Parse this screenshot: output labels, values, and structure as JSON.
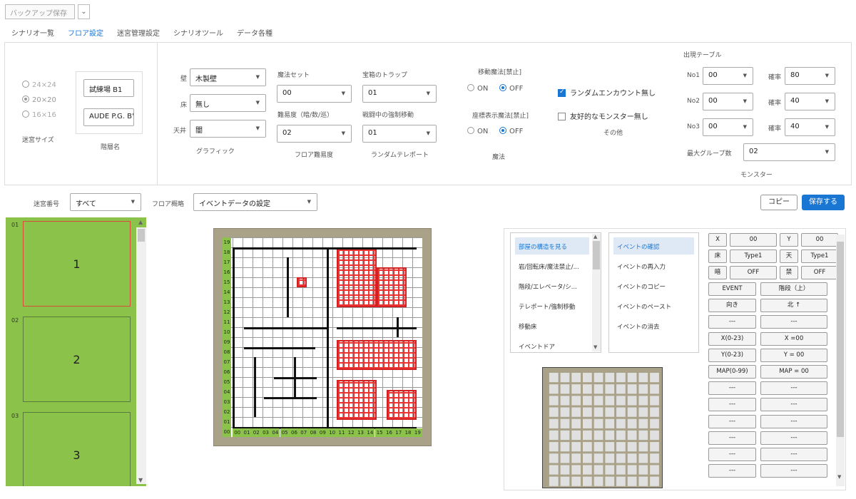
{
  "top": {
    "backup_label": "バックアップ保存"
  },
  "tabs": [
    {
      "label": "シナリオ一覧"
    },
    {
      "label": "フロア設定"
    },
    {
      "label": "迷宮管理設定"
    },
    {
      "label": "シナリオツール"
    },
    {
      "label": "データ各種"
    }
  ],
  "size": {
    "opt1": "24×24",
    "opt2": "20×20",
    "opt3": "16×16",
    "caption": "迷宮サイズ",
    "selected": "20×20"
  },
  "floorname": {
    "name1": "試練場 B1",
    "name2": "AUDE P.G. B'",
    "caption": "階層名"
  },
  "graphic": {
    "wall_label": "壁",
    "wall_value": "木製壁",
    "floor_label": "床",
    "floor_value": "無し",
    "ceiling_label": "天井",
    "ceiling_value": "闇",
    "caption": "グラフィック"
  },
  "difficulty": {
    "magicset_label": "魔法セット",
    "magicset_value": "00",
    "level_label": "難易度（暗/数/巡）",
    "level_value": "02",
    "caption": "フロア難易度"
  },
  "teleport": {
    "trap_label": "宝箱のトラップ",
    "trap_value": "01",
    "force_label": "戦闘中の強制移動",
    "force_value": "01",
    "caption": "ランダムテレポート"
  },
  "magic": {
    "move_label": "移動魔法[禁止]",
    "move_on": "ON",
    "move_off": "OFF",
    "coord_label": "座標表示魔法[禁止]",
    "coord_on": "ON",
    "coord_off": "OFF",
    "caption": "魔法"
  },
  "other": {
    "random_label": "ランダムエンカウント無し",
    "friendly_label": "友好的なモンスター無し",
    "caption": "その他"
  },
  "monster": {
    "table_label": "出現テーブル",
    "rows": [
      {
        "no": "No1",
        "value": "00",
        "rate_label": "確率",
        "rate": "80"
      },
      {
        "no": "No2",
        "value": "00",
        "rate_label": "確率",
        "rate": "40"
      },
      {
        "no": "No3",
        "value": "00",
        "rate_label": "確率",
        "rate": "40"
      }
    ],
    "maxgroup_label": "最大グループ数",
    "maxgroup_value": "02",
    "caption": "モンスター"
  },
  "toolbar": {
    "maze_no_label": "迷宮番号",
    "maze_no_value": "すべて",
    "outline_label": "フロア概略",
    "outline_value": "イベントデータの設定",
    "copy": "コピー",
    "save": "保存する"
  },
  "floors": [
    {
      "no": "01",
      "title": "1"
    },
    {
      "no": "02",
      "title": "2"
    },
    {
      "no": "03",
      "title": "3"
    }
  ],
  "map": {
    "rows": [
      "19",
      "18",
      "17",
      "16",
      "15",
      "14",
      "13",
      "12",
      "11",
      "10",
      "09",
      "08",
      "07",
      "06",
      "05",
      "04",
      "03",
      "02",
      "01",
      "00"
    ],
    "cols": [
      "00",
      "01",
      "02",
      "03",
      "04",
      "05",
      "06",
      "07",
      "08",
      "09",
      "10",
      "11",
      "12",
      "13",
      "14",
      "15",
      "16",
      "17",
      "18",
      "19"
    ]
  },
  "menu_left": [
    "部屋の構造を見る",
    "岩/回転床/魔法禁止/...",
    "階段/エレベータ/シ...",
    "テレポート/強制移動",
    "移動床",
    "イベントドア"
  ],
  "menu_right": [
    "イベントの確認",
    "イベントの再入力",
    "イベントのコピー",
    "イベントのペースト",
    "イベントの消去"
  ],
  "props": [
    [
      "X",
      "00",
      "Y",
      "00"
    ],
    [
      "床",
      "Type1",
      "天",
      "Type1"
    ],
    [
      "暗",
      "OFF",
      "禁",
      "OFF"
    ]
  ],
  "props_wide": [
    [
      "EVENT",
      "階段（上）"
    ],
    [
      "向き",
      "北 ↑"
    ],
    [
      "---",
      "---"
    ],
    [
      "X(0-23)",
      "X =00"
    ],
    [
      "Y(0-23)",
      "Y = 00"
    ],
    [
      "MAP(0-99)",
      "MAP = 00"
    ],
    [
      "---",
      "---"
    ],
    [
      "---",
      "---"
    ],
    [
      "---",
      "---"
    ],
    [
      "---",
      "---"
    ],
    [
      "---",
      "---"
    ],
    [
      "---",
      "---"
    ]
  ]
}
